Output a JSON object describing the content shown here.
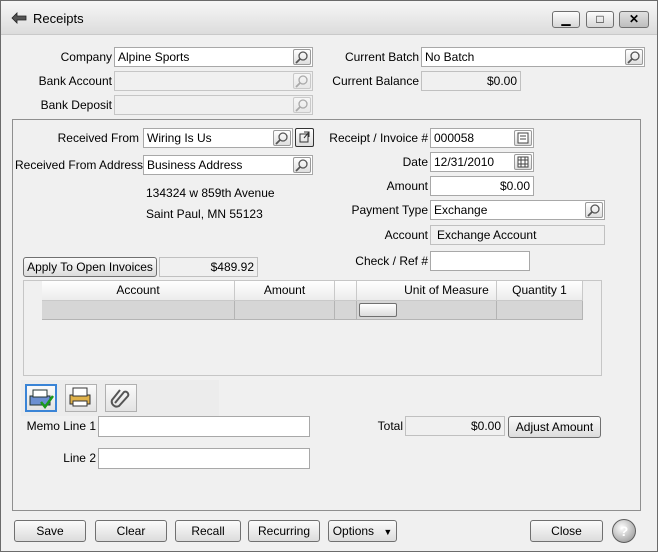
{
  "window": {
    "title": "Receipts",
    "controls": {
      "minimize": "▁",
      "maximize": "□",
      "close": "✕"
    }
  },
  "header": {
    "company_label": "Company",
    "company_value": "Alpine Sports",
    "bank_account_label": "Bank Account",
    "bank_account_value": "",
    "bank_deposit_label": "Bank Deposit",
    "bank_deposit_value": "",
    "current_batch_label": "Current Batch",
    "current_batch_value": "No Batch",
    "current_balance_label": "Current Balance",
    "current_balance_value": "$0.00"
  },
  "form": {
    "received_from_label": "Received From",
    "received_from_value": "Wiring Is Us",
    "received_from_address_label": "Received From Address",
    "received_from_address_value": "Business Address",
    "address_line1": "134324 w 859th Avenue",
    "address_line2": "Saint Paul, MN  55123",
    "receipt_invoice_label": "Receipt / Invoice #",
    "receipt_invoice_value": "000058",
    "date_label": "Date",
    "date_value": "12/31/2010",
    "amount_label": "Amount",
    "amount_value": "$0.00",
    "payment_type_label": "Payment Type",
    "payment_type_value": "Exchange",
    "account_label": "Account",
    "account_value": "Exchange Account",
    "check_ref_label": "Check / Ref #",
    "check_ref_value": "",
    "apply_open_invoices_label": "Apply To Open Invoices",
    "apply_open_invoices_value": "$489.92"
  },
  "grid": {
    "columns": [
      "Account",
      "Amount",
      "",
      "Unit of Measure",
      "Quantity 1"
    ],
    "rows": [
      [
        "",
        "",
        "",
        "",
        ""
      ]
    ]
  },
  "memo": {
    "memo_line1_label": "Memo Line 1",
    "memo_line1_value": "",
    "line2_label": "Line 2",
    "line2_value": "",
    "total_label": "Total",
    "total_value": "$0.00",
    "adjust_amount_label": "Adjust Amount"
  },
  "footer": {
    "save": "Save",
    "clear": "Clear",
    "recall": "Recall",
    "recurring": "Recurring",
    "options": "Options",
    "close": "Close",
    "help": "?"
  },
  "icons": {
    "toolbar": [
      "check-print-icon",
      "print-icon",
      "attachment-icon"
    ],
    "lookup": "magnifier-icon",
    "calendar": "calendar-icon"
  }
}
